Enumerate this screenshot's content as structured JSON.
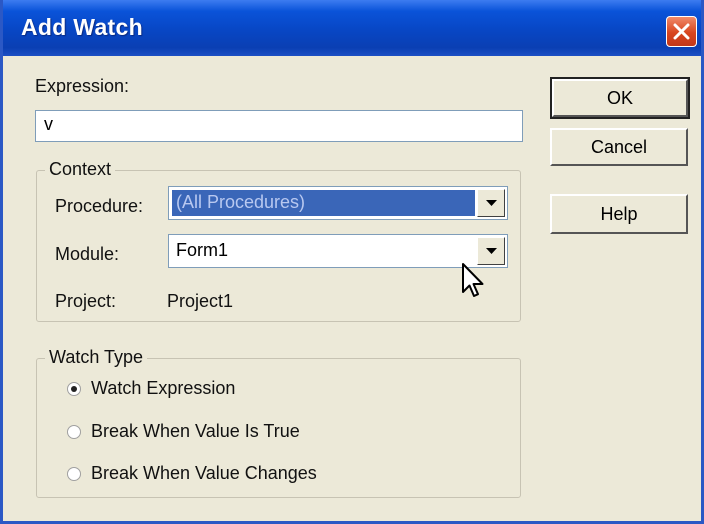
{
  "window": {
    "title": "Add Watch"
  },
  "expression": {
    "label": "Expression:",
    "value": "v"
  },
  "context": {
    "title": "Context",
    "procedure": {
      "label": "Procedure:",
      "value": "(All Procedures)"
    },
    "module": {
      "label": "Module:",
      "value": "Form1"
    },
    "project": {
      "label": "Project:",
      "value": "Project1"
    }
  },
  "watch_type": {
    "title": "Watch Type",
    "options": [
      {
        "label": "Watch Expression",
        "checked": true
      },
      {
        "label": "Break When Value Is True",
        "checked": false
      },
      {
        "label": "Break When Value Changes",
        "checked": false
      }
    ]
  },
  "buttons": {
    "ok": "OK",
    "cancel": "Cancel",
    "help": "Help"
  },
  "icons": {
    "close": "close-icon",
    "arrow": "chevron-down-icon",
    "cursor": "mouse-pointer-icon"
  },
  "colors": {
    "titlebar": "#0846c4",
    "selection": "#3a66b8",
    "close": "#d8451f"
  }
}
